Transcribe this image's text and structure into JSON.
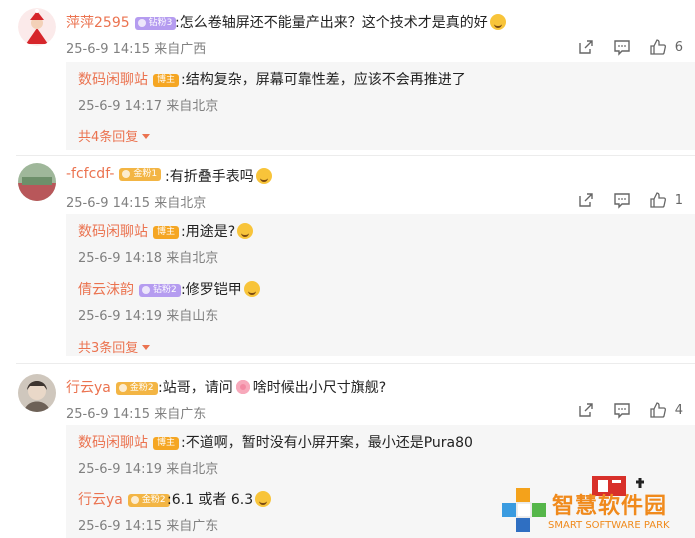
{
  "comments": [
    {
      "user": "萍萍2595",
      "badge": "钻粉3",
      "text": ":怎么卷轴屏还不能量产出来？这个技术才是真的好",
      "meta": "25-6-9 14:15 来自广西",
      "likes": "6",
      "replies": [
        {
          "user": "数码闲聊站",
          "badge": "博主",
          "text": ":结构复杂，屏幕可靠性差，应该不会再推进了",
          "meta": "25-6-9 14:17 来自北京"
        }
      ],
      "reply_count": "共4条回复"
    },
    {
      "user": "-fcfcdf-",
      "badge": "金粉1",
      "text": ":有折叠手表吗",
      "meta": "25-6-9 14:15 来自北京",
      "likes": "1",
      "replies": [
        {
          "user": "数码闲聊站",
          "badge": "博主",
          "text": ":用途是?",
          "meta": "25-6-9 14:18 来自北京"
        },
        {
          "user": "倩云沫韵",
          "badge": "钻粉2",
          "text": ":修罗铠甲",
          "meta": "25-6-9 14:19 来自山东"
        }
      ],
      "reply_count": "共3条回复"
    },
    {
      "user": "行云ya",
      "badge": "金粉2",
      "text_before": ":站哥，请问",
      "text_after": "啥时候出小尺寸旗舰?",
      "meta": "25-6-9 14:15 来自广东",
      "likes": "4",
      "replies": [
        {
          "user": "数码闲聊站",
          "badge": "博主",
          "text": ":不道啊，暂时没有小屏开案，最小还是Pura80",
          "meta": "25-6-9 14:19 来自北京"
        },
        {
          "user": "行云ya",
          "badge": "金粉2",
          "text": ":6.1 或者 6.3",
          "meta": "25-6-9 14:15 来自广东"
        }
      ]
    }
  ],
  "watermark": {
    "title": "智慧软件园",
    "subtitle": "SMART SOFTWARE PARK"
  },
  "colors": {
    "username": "#eb7350",
    "meta": "#808080",
    "reply_bg": "#f6f6f6"
  }
}
